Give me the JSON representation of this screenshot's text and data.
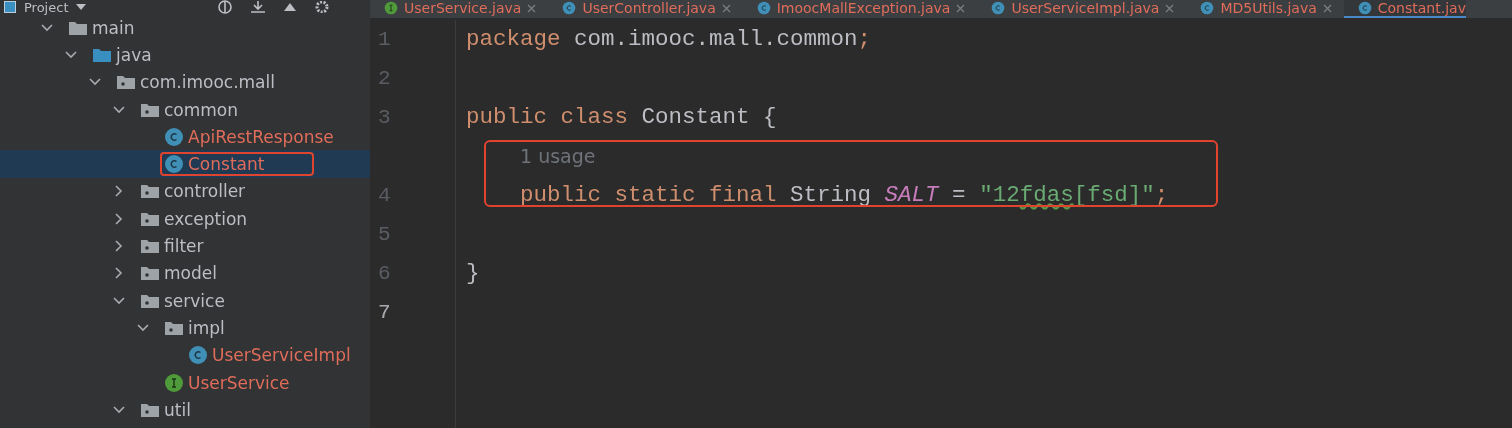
{
  "project_header": {
    "title": "Project"
  },
  "tree": [
    {
      "label": "main",
      "kind": "folder",
      "expanded": true,
      "children": [
        {
          "label": "java",
          "kind": "source",
          "expanded": true,
          "children": [
            {
              "label": "com.imooc.mall",
              "kind": "package",
              "expanded": true,
              "children": [
                {
                  "label": "common",
                  "kind": "package",
                  "expanded": true,
                  "children": [
                    {
                      "label": "ApiRestResponse",
                      "kind": "class",
                      "modified": true,
                      "selected": false,
                      "highlighted": false
                    },
                    {
                      "label": "Constant",
                      "kind": "class",
                      "modified": true,
                      "selected": true,
                      "highlighted": true
                    }
                  ]
                },
                {
                  "label": "controller",
                  "kind": "package",
                  "expanded": false
                },
                {
                  "label": "exception",
                  "kind": "package",
                  "expanded": false
                },
                {
                  "label": "filter",
                  "kind": "package",
                  "expanded": false
                },
                {
                  "label": "model",
                  "kind": "package",
                  "expanded": false
                },
                {
                  "label": "service",
                  "kind": "package",
                  "expanded": true,
                  "children": [
                    {
                      "label": "impl",
                      "kind": "package",
                      "expanded": true,
                      "children": [
                        {
                          "label": "UserServiceImpl",
                          "kind": "class",
                          "modified": true,
                          "selected": false,
                          "highlighted": false
                        }
                      ]
                    },
                    {
                      "label": "UserService",
                      "kind": "interface",
                      "modified": true,
                      "selected": false,
                      "highlighted": false
                    }
                  ]
                },
                {
                  "label": "util",
                  "kind": "package",
                  "expanded": true
                }
              ]
            }
          ]
        }
      ]
    }
  ],
  "tabs": [
    {
      "label": "UserService.java",
      "kind": "interface",
      "selected": false
    },
    {
      "label": "UserController.java",
      "kind": "class",
      "selected": false
    },
    {
      "label": "ImoocMallException.java",
      "kind": "class",
      "selected": false
    },
    {
      "label": "UserServiceImpl.java",
      "kind": "class",
      "selected": false
    },
    {
      "label": "MD5Utils.java",
      "kind": "class",
      "selected": false
    },
    {
      "label": "Constant.jav",
      "kind": "class",
      "selected": true
    }
  ],
  "editor": {
    "lines": [
      {
        "number": "1",
        "current": false,
        "tokens": [
          {
            "text": "package",
            "kind": "keyword"
          },
          {
            "text": " com.imooc.mall.common",
            "kind": "plain"
          },
          {
            "text": ";",
            "kind": "keyword"
          }
        ]
      },
      {
        "number": "2",
        "current": false
      },
      {
        "number": "3",
        "current": false,
        "tokens": [
          {
            "text": "public class",
            "kind": "keyword"
          },
          {
            "text": " Constant {",
            "kind": "plain"
          }
        ]
      },
      {
        "hint": "1 usage"
      },
      {
        "number": "4",
        "current": false,
        "highlighted": true,
        "tokens": [
          {
            "text": "    public static final",
            "kind": "keyword"
          },
          {
            "text": " String ",
            "kind": "plain"
          },
          {
            "text": "SALT",
            "kind": "constant"
          },
          {
            "text": " = ",
            "kind": "plain"
          },
          {
            "text": "\"12",
            "kind": "string"
          },
          {
            "text": "fdas",
            "kind": "typo"
          },
          {
            "text": "[fsd]\"",
            "kind": "string"
          },
          {
            "text": ";",
            "kind": "keyword"
          }
        ]
      },
      {
        "number": "5",
        "current": false
      },
      {
        "number": "6",
        "current": false,
        "tokens": [
          {
            "text": "}",
            "kind": "plain"
          }
        ]
      },
      {
        "number": "7",
        "current": true
      }
    ]
  }
}
